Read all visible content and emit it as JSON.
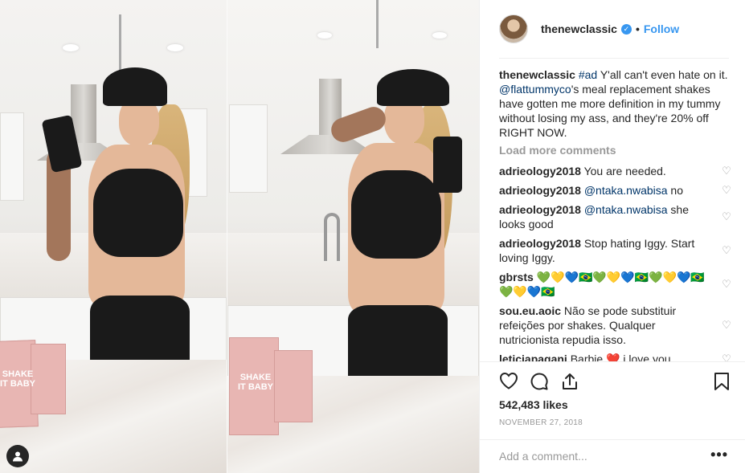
{
  "post": {
    "username": "thenewclassic",
    "verified_glyph": "✓",
    "dot": "•",
    "follow_label": "Follow",
    "caption": {
      "user": "thenewclassic",
      "hashtag": "#ad",
      "text_1": " Y'all can't even hate on it. ",
      "mention": "@flattummyco",
      "text_2": "'s meal replacement shakes have gotten me more definition in my tummy without losing my ass, and they're 20% off RIGHT NOW."
    },
    "load_more_label": "Load more comments",
    "comments": [
      {
        "user": "adrieology2018",
        "text": " You are needed.",
        "mention": ""
      },
      {
        "user": "adrieology2018",
        "text": " no",
        "mention": " @ntaka.nwabisa"
      },
      {
        "user": "adrieology2018",
        "text": " she looks good",
        "mention": " @ntaka.nwabisa"
      },
      {
        "user": "adrieology2018",
        "text": " Stop hating Iggy. Start loving Iggy.",
        "mention": ""
      },
      {
        "user": "gbrsts",
        "text": " 💚💛💙🇧🇷💚💛💙🇧🇷💚💛💙🇧🇷💚💛💙🇧🇷",
        "mention": ""
      },
      {
        "user": "sou.eu.aoic",
        "text": " Não se pode substituir refeições por shakes. Qualquer nutricionista repudia isso.",
        "mention": ""
      },
      {
        "user": "leticiapagani",
        "text": " Barbie ❤️ i love you",
        "mention": ""
      }
    ],
    "likes": "542,483 likes",
    "date": "NOVEMBER 27, 2018",
    "add_comment_placeholder": "Add a comment...",
    "more_options": "•••",
    "photo": {
      "product_left_text": "SHAKE IT BABY",
      "product_right_text": "SHAKE IT BABY"
    }
  },
  "icons": {
    "like": "heart-icon",
    "comment": "speech-bubble-icon",
    "share": "share-icon",
    "save": "bookmark-icon",
    "tag": "user-tag-icon",
    "comment_like": "small-heart-icon"
  },
  "colors": {
    "link_blue": "#3897f0",
    "text": "#262626",
    "muted": "#999999",
    "mention_blue": "#003569"
  }
}
